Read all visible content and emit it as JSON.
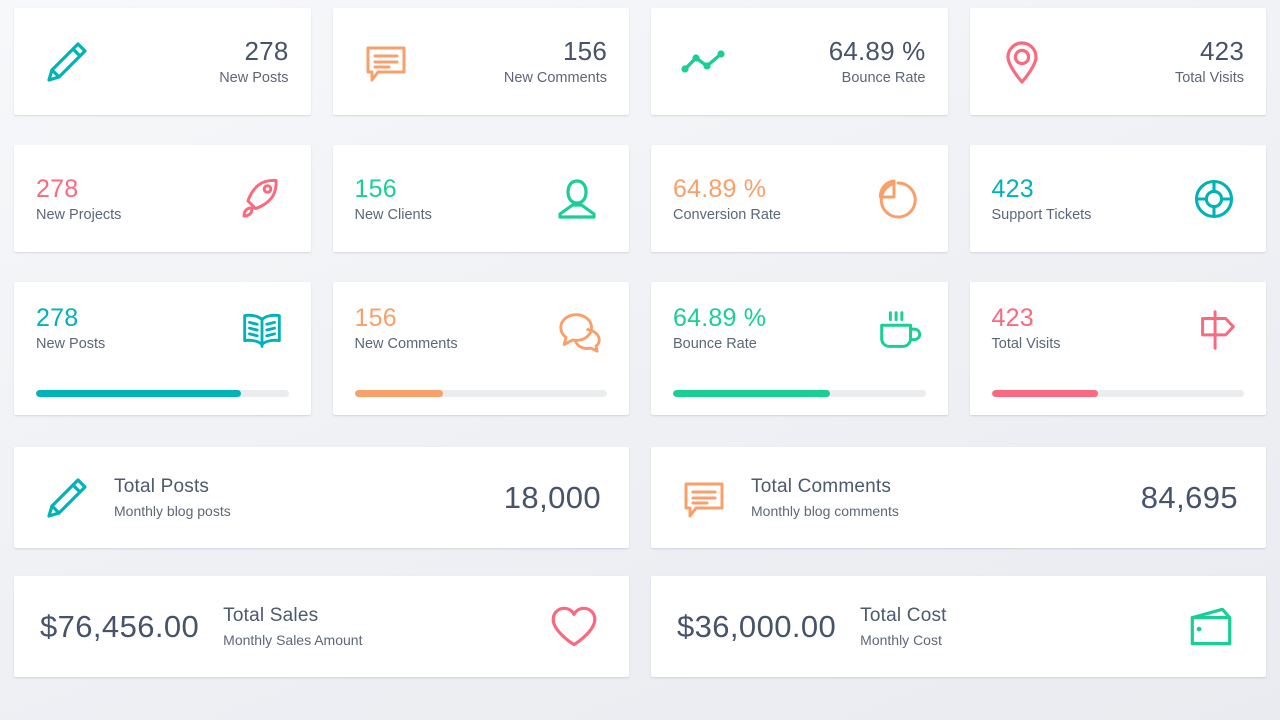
{
  "colors": {
    "teal": "#00b3b7",
    "orange": "#f9a06a",
    "green": "#19cf96",
    "pink": "#fa6a7e",
    "value_dark": "#46536b",
    "label": "#5b6779",
    "track": "#ebeced",
    "card_bg": "#ffffff",
    "page_bg": "#f2f3f7"
  },
  "row1": [
    {
      "icon": "pencil-icon",
      "color": "#00b3b7",
      "value": "278",
      "label": "New Posts"
    },
    {
      "icon": "comment-box-icon",
      "color": "#f9a06a",
      "value": "156",
      "label": "New Comments"
    },
    {
      "icon": "line-chart-icon",
      "color": "#19cf96",
      "value": "64.89 %",
      "label": "Bounce Rate"
    },
    {
      "icon": "map-pin-icon",
      "color": "#fa6a7e",
      "value": "423",
      "label": "Total Visits"
    }
  ],
  "row2": [
    {
      "icon": "rocket-icon",
      "color": "#fa6a7e",
      "value": "278",
      "label": "New Projects"
    },
    {
      "icon": "user-icon",
      "color": "#19cf96",
      "value": "156",
      "label": "New Clients"
    },
    {
      "icon": "pie-chart-icon",
      "color": "#f9a06a",
      "value": "64.89 %",
      "label": "Conversion Rate"
    },
    {
      "icon": "life-ring-icon",
      "color": "#00b3b7",
      "value": "423",
      "label": "Support Tickets"
    }
  ],
  "row3": [
    {
      "icon": "open-book-icon",
      "color": "#00b3b7",
      "value": "278",
      "label": "New Posts",
      "progress": 81
    },
    {
      "icon": "chat-bubbles-icon",
      "color": "#f9a06a",
      "value": "156",
      "label": "New Comments",
      "progress": 35
    },
    {
      "icon": "coffee-cup-icon",
      "color": "#19cf96",
      "value": "64.89 %",
      "label": "Bounce Rate",
      "progress": 62
    },
    {
      "icon": "signpost-icon",
      "color": "#fa6a7e",
      "value": "423",
      "label": "Total Visits",
      "progress": 42
    }
  ],
  "row4": [
    {
      "icon": "pencil-icon",
      "color": "#00b3b7",
      "title": "Total Posts",
      "subtitle": "Monthly blog posts",
      "value": "18,000"
    },
    {
      "icon": "comment-box-icon",
      "color": "#f9a06a",
      "title": "Total Comments",
      "subtitle": "Monthly blog comments",
      "value": "84,695"
    }
  ],
  "row5": [
    {
      "icon": "heart-icon",
      "color": "#fa6a7e",
      "value": "$76,456.00",
      "title": "Total Sales",
      "subtitle": "Monthly Sales Amount"
    },
    {
      "icon": "wallet-icon",
      "color": "#19cf96",
      "value": "$36,000.00",
      "title": "Total Cost",
      "subtitle": "Monthly Cost"
    }
  ]
}
